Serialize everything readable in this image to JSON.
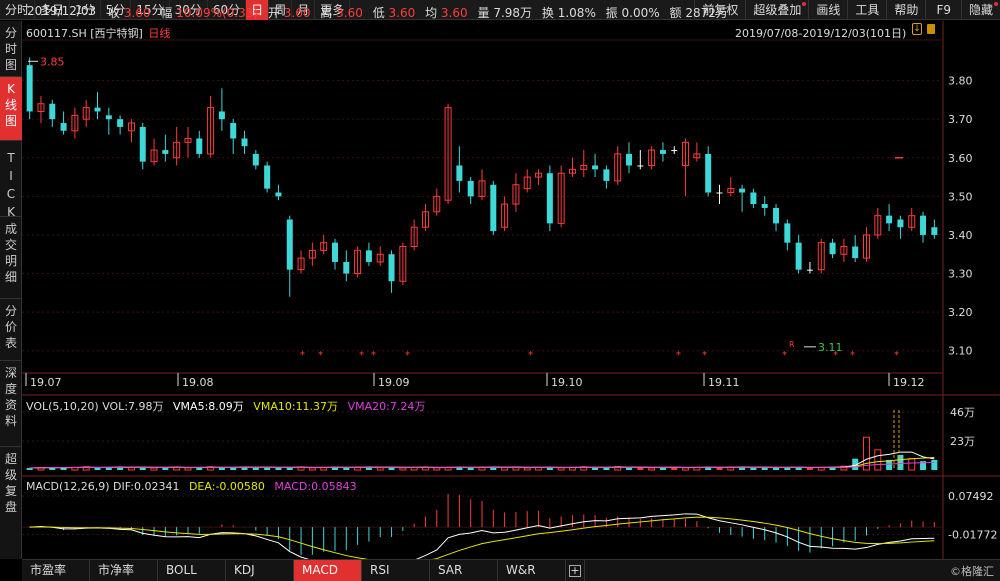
{
  "topbar": {
    "date": "2019/12/03",
    "periods": [
      "分时",
      "多日",
      "1分",
      "5分",
      "15分",
      "30分",
      "60分",
      "日",
      "周",
      "月",
      "更多"
    ],
    "active_period": "日",
    "quote": {
      "close_label": "收",
      "close": "3.60",
      "change_label": "幅",
      "change": "10.09%(0.33)",
      "open_label": "开",
      "open": "3.60",
      "high_label": "高",
      "high": "3.60",
      "low_label": "低",
      "low": "3.60",
      "avg_label": "均",
      "avg": "3.60",
      "volume_label": "量",
      "volume": "7.98万",
      "turnover_label": "换",
      "turnover": "1.08%",
      "amplitude_label": "振",
      "amplitude": "0.00%",
      "amount_label": "额",
      "amount": "2872万"
    },
    "right_buttons": [
      "前复权",
      "超级叠加",
      "画线",
      "工具",
      "帮助",
      "F9",
      "隐藏"
    ]
  },
  "sidebar": [
    "分时图",
    "K线图",
    "TICK",
    "成交明细",
    "分价表",
    "深度资料",
    "超级复盘"
  ],
  "sidebar_active": "K线图",
  "stock": {
    "code": "600117.SH",
    "name": "[西宁特钢]",
    "period": "日线"
  },
  "range": "2019/07/08-2019/12/03(101日)",
  "watermark": "©格隆汇",
  "colors": {
    "up": "#ff3b3b",
    "down": "#3ed8d8",
    "bg": "#000000",
    "grid": "#5a1a1a",
    "active": "#e03030"
  },
  "chart_data": [
    {
      "type": "candlestick",
      "price_ticks": [
        "3.80",
        "3.70",
        "3.60",
        "3.50",
        "3.40",
        "3.30",
        "3.20",
        "3.10"
      ],
      "ylim": [
        3.05,
        3.9
      ],
      "x_labels": [
        "19.07",
        "19.08",
        "19.09",
        "19.10",
        "19.11",
        "19.12"
      ],
      "max_label": "3.85",
      "min_label": "3.11",
      "marker_label": "R",
      "last_close_label": "3.60",
      "candles": [
        [
          3.84,
          3.72,
          3.86,
          3.7
        ],
        [
          3.72,
          3.74,
          3.76,
          3.69
        ],
        [
          3.74,
          3.7,
          3.75,
          3.68
        ],
        [
          3.69,
          3.67,
          3.72,
          3.66
        ],
        [
          3.67,
          3.71,
          3.73,
          3.65
        ],
        [
          3.7,
          3.73,
          3.75,
          3.68
        ],
        [
          3.73,
          3.72,
          3.77,
          3.7
        ],
        [
          3.71,
          3.7,
          3.73,
          3.66
        ],
        [
          3.7,
          3.68,
          3.71,
          3.66
        ],
        [
          3.67,
          3.69,
          3.7,
          3.64
        ],
        [
          3.68,
          3.59,
          3.69,
          3.57
        ],
        [
          3.59,
          3.62,
          3.65,
          3.58
        ],
        [
          3.62,
          3.61,
          3.66,
          3.59
        ],
        [
          3.6,
          3.64,
          3.68,
          3.58
        ],
        [
          3.64,
          3.65,
          3.68,
          3.6
        ],
        [
          3.65,
          3.61,
          3.67,
          3.6
        ],
        [
          3.61,
          3.73,
          3.76,
          3.6
        ],
        [
          3.72,
          3.7,
          3.78,
          3.67
        ],
        [
          3.69,
          3.65,
          3.7,
          3.61
        ],
        [
          3.65,
          3.63,
          3.67,
          3.61
        ],
        [
          3.61,
          3.58,
          3.62,
          3.57
        ],
        [
          3.58,
          3.52,
          3.59,
          3.51
        ],
        [
          3.51,
          3.5,
          3.53,
          3.49
        ],
        [
          3.44,
          3.31,
          3.45,
          3.24
        ],
        [
          3.31,
          3.34,
          3.36,
          3.3
        ],
        [
          3.34,
          3.36,
          3.38,
          3.32
        ],
        [
          3.36,
          3.38,
          3.4,
          3.35
        ],
        [
          3.38,
          3.33,
          3.39,
          3.31
        ],
        [
          3.33,
          3.3,
          3.36,
          3.28
        ],
        [
          3.3,
          3.36,
          3.37,
          3.29
        ],
        [
          3.36,
          3.33,
          3.38,
          3.32
        ],
        [
          3.33,
          3.35,
          3.37,
          3.32
        ],
        [
          3.35,
          3.28,
          3.36,
          3.25
        ],
        [
          3.28,
          3.37,
          3.38,
          3.27
        ],
        [
          3.37,
          3.42,
          3.44,
          3.36
        ],
        [
          3.42,
          3.46,
          3.48,
          3.41
        ],
        [
          3.46,
          3.5,
          3.52,
          3.45
        ],
        [
          3.49,
          3.73,
          3.74,
          3.48
        ],
        [
          3.58,
          3.54,
          3.63,
          3.51
        ],
        [
          3.54,
          3.5,
          3.55,
          3.48
        ],
        [
          3.5,
          3.54,
          3.57,
          3.49
        ],
        [
          3.53,
          3.41,
          3.54,
          3.4
        ],
        [
          3.42,
          3.48,
          3.5,
          3.41
        ],
        [
          3.48,
          3.53,
          3.56,
          3.46
        ],
        [
          3.52,
          3.55,
          3.57,
          3.51
        ],
        [
          3.55,
          3.56,
          3.57,
          3.53
        ],
        [
          3.56,
          3.43,
          3.58,
          3.41
        ],
        [
          3.43,
          3.56,
          3.58,
          3.42
        ],
        [
          3.56,
          3.57,
          3.6,
          3.55
        ],
        [
          3.57,
          3.58,
          3.62,
          3.55
        ],
        [
          3.58,
          3.57,
          3.61,
          3.55
        ],
        [
          3.57,
          3.54,
          3.58,
          3.52
        ],
        [
          3.54,
          3.61,
          3.63,
          3.53
        ],
        [
          3.61,
          3.58,
          3.64,
          3.56
        ],
        [
          3.58,
          3.58,
          3.62,
          3.57
        ],
        [
          3.58,
          3.62,
          3.63,
          3.57
        ],
        [
          3.62,
          3.61,
          3.64,
          3.59
        ],
        [
          3.62,
          3.62,
          3.63,
          3.61
        ],
        [
          3.58,
          3.64,
          3.65,
          3.5
        ],
        [
          3.6,
          3.61,
          3.64,
          3.59
        ],
        [
          3.61,
          3.51,
          3.63,
          3.5
        ],
        [
          3.51,
          3.51,
          3.53,
          3.48
        ],
        [
          3.51,
          3.52,
          3.55,
          3.5
        ],
        [
          3.52,
          3.51,
          3.53,
          3.46
        ],
        [
          3.51,
          3.48,
          3.52,
          3.47
        ],
        [
          3.48,
          3.47,
          3.5,
          3.45
        ],
        [
          3.47,
          3.43,
          3.48,
          3.41
        ],
        [
          3.43,
          3.38,
          3.44,
          3.36
        ],
        [
          3.38,
          3.31,
          3.4,
          3.3
        ],
        [
          3.31,
          3.31,
          3.33,
          3.3
        ],
        [
          3.31,
          3.38,
          3.39,
          3.3
        ],
        [
          3.38,
          3.35,
          3.39,
          3.34
        ],
        [
          3.35,
          3.37,
          3.39,
          3.33
        ],
        [
          3.37,
          3.34,
          3.4,
          3.33
        ],
        [
          3.34,
          3.4,
          3.42,
          3.33
        ],
        [
          3.4,
          3.45,
          3.47,
          3.39
        ],
        [
          3.45,
          3.43,
          3.48,
          3.41
        ],
        [
          3.44,
          3.42,
          3.45,
          3.39
        ],
        [
          3.42,
          3.45,
          3.47,
          3.41
        ],
        [
          3.45,
          3.4,
          3.46,
          3.38
        ],
        [
          3.42,
          3.4,
          3.44,
          3.39
        ]
      ]
    },
    {
      "type": "bar",
      "title": "VOL(5,10,20)",
      "legend": [
        {
          "name": "VOL",
          "value": "7.98万"
        },
        {
          "name": "VMA5",
          "value": "8.09万"
        },
        {
          "name": "VMA10",
          "value": "11.37万"
        },
        {
          "name": "VMA20",
          "value": "7.24万"
        }
      ],
      "y_ticks": [
        "46万",
        "23万"
      ],
      "ylim": [
        0,
        46
      ]
    },
    {
      "type": "bar",
      "title": "MACD(12,26,9)",
      "legend": [
        {
          "name": "DIF",
          "value": "0.02341"
        },
        {
          "name": "DEA",
          "value": "-0.00580"
        },
        {
          "name": "MACD",
          "value": "0.05843"
        }
      ],
      "y_ticks": [
        "0.07492",
        "-0.01772"
      ]
    }
  ]
}
